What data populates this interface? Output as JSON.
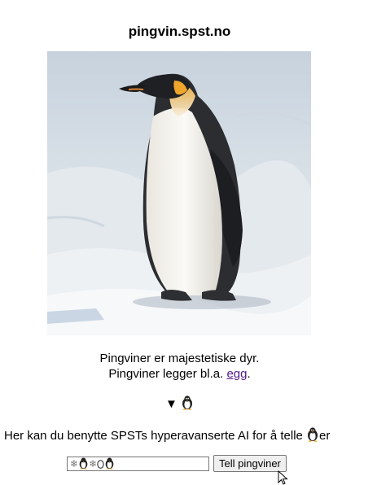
{
  "site": {
    "title": "pingvin.spst.no"
  },
  "image": {
    "subject": "emperor-penguin-photo"
  },
  "description": {
    "line1": "Pingviner er majestetiske dyr.",
    "line2_prefix": "Pingviner legger bl.a. ",
    "line2_link": "egg",
    "line2_suffix": "."
  },
  "toggle": {
    "arrow": "▼"
  },
  "intro": {
    "prefix": "Her kan du benytte SPSTs hyperavanserte AI for å telle ",
    "suffix": "er"
  },
  "counter": {
    "input_value_symbols": [
      "❄",
      "penguin-icon",
      "❄",
      "egg",
      "penguin-icon"
    ],
    "snow": "❄",
    "egg": "0",
    "button_label": "Tell pingviner"
  },
  "colors": {
    "link_visited": "#551a8b",
    "button_bg": "#efefef",
    "input_border": "#767676"
  }
}
